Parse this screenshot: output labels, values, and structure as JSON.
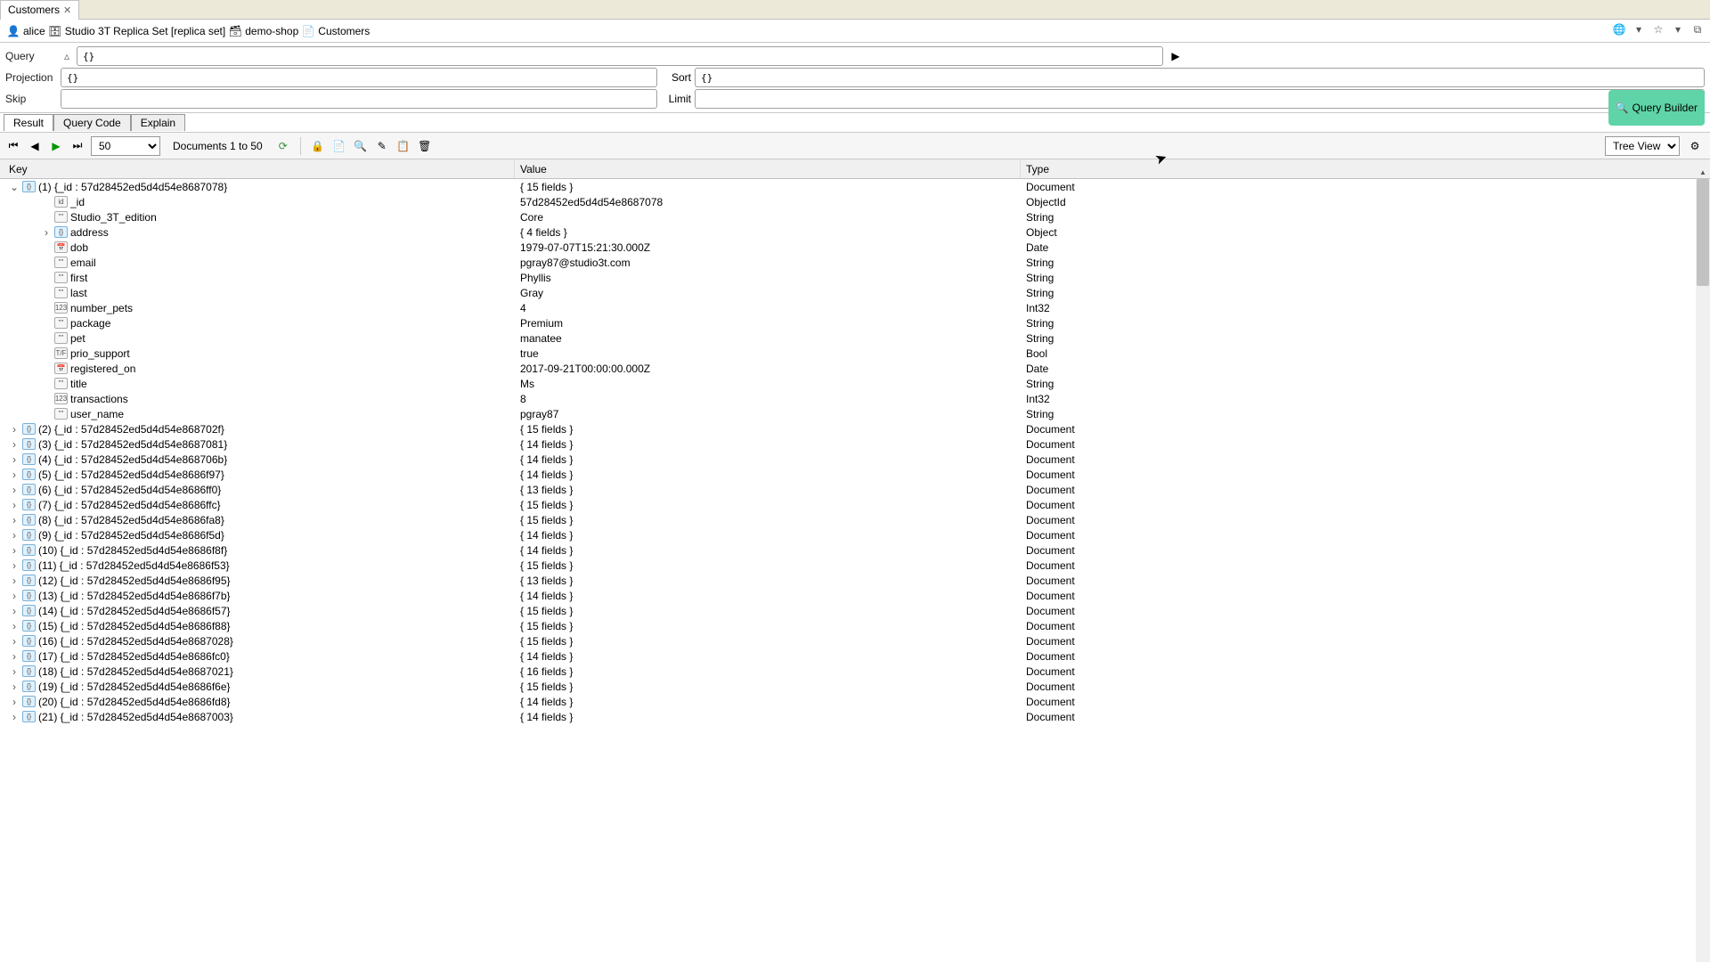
{
  "tab": {
    "title": "Customers"
  },
  "breadcrumb": {
    "user": "alice",
    "connection": "Studio 3T Replica Set [replica set]",
    "database": "demo-shop",
    "collection": "Customers"
  },
  "query_form": {
    "query_label": "Query",
    "query_value": "{}",
    "projection_label": "Projection",
    "projection_value": "{}",
    "sort_label": "Sort",
    "sort_value": "{}",
    "skip_label": "Skip",
    "skip_value": "",
    "limit_label": "Limit",
    "limit_value": "",
    "builder_label": "Query Builder"
  },
  "result_tabs": {
    "result": "Result",
    "code": "Query Code",
    "explain": "Explain"
  },
  "toolbar": {
    "page_size": "50",
    "doc_range": "Documents 1 to 50",
    "view_mode": "Tree View"
  },
  "grid_headers": {
    "key": "Key",
    "value": "Value",
    "type": "Type"
  },
  "doc1": {
    "key": "(1) {_id : 57d28452ed5d4d54e8687078}",
    "value": "{ 15 fields }",
    "type": "Document",
    "fields": [
      {
        "k": "_id",
        "v": "57d28452ed5d4d54e8687078",
        "t": "ObjectId",
        "icon": "id"
      },
      {
        "k": "Studio_3T_edition",
        "v": "Core",
        "t": "String",
        "icon": "str"
      },
      {
        "k": "address",
        "v": "{ 4 fields }",
        "t": "Object",
        "icon": "obj",
        "expandable": true
      },
      {
        "k": "dob",
        "v": "1979-07-07T15:21:30.000Z",
        "t": "Date",
        "icon": "date"
      },
      {
        "k": "email",
        "v": "pgray87@studio3t.com",
        "t": "String",
        "icon": "str"
      },
      {
        "k": "first",
        "v": "Phyllis",
        "t": "String",
        "icon": "str"
      },
      {
        "k": "last",
        "v": "Gray",
        "t": "String",
        "icon": "str"
      },
      {
        "k": "number_pets",
        "v": "4",
        "t": "Int32",
        "icon": "int"
      },
      {
        "k": "package",
        "v": "Premium",
        "t": "String",
        "icon": "str"
      },
      {
        "k": "pet",
        "v": "manatee",
        "t": "String",
        "icon": "str"
      },
      {
        "k": "prio_support",
        "v": "true",
        "t": "Bool",
        "icon": "bool"
      },
      {
        "k": "registered_on",
        "v": "2017-09-21T00:00:00.000Z",
        "t": "Date",
        "icon": "date"
      },
      {
        "k": "title",
        "v": "Ms",
        "t": "String",
        "icon": "str"
      },
      {
        "k": "transactions",
        "v": "8",
        "t": "Int32",
        "icon": "int"
      },
      {
        "k": "user_name",
        "v": "pgray87",
        "t": "String",
        "icon": "str"
      }
    ]
  },
  "other_docs": [
    {
      "k": "(2) {_id : 57d28452ed5d4d54e868702f}",
      "v": "{ 15 fields }",
      "t": "Document"
    },
    {
      "k": "(3) {_id : 57d28452ed5d4d54e8687081}",
      "v": "{ 14 fields }",
      "t": "Document"
    },
    {
      "k": "(4) {_id : 57d28452ed5d4d54e868706b}",
      "v": "{ 14 fields }",
      "t": "Document"
    },
    {
      "k": "(5) {_id : 57d28452ed5d4d54e8686f97}",
      "v": "{ 14 fields }",
      "t": "Document"
    },
    {
      "k": "(6) {_id : 57d28452ed5d4d54e8686ff0}",
      "v": "{ 13 fields }",
      "t": "Document"
    },
    {
      "k": "(7) {_id : 57d28452ed5d4d54e8686ffc}",
      "v": "{ 15 fields }",
      "t": "Document"
    },
    {
      "k": "(8) {_id : 57d28452ed5d4d54e8686fa8}",
      "v": "{ 15 fields }",
      "t": "Document"
    },
    {
      "k": "(9) {_id : 57d28452ed5d4d54e8686f5d}",
      "v": "{ 14 fields }",
      "t": "Document"
    },
    {
      "k": "(10) {_id : 57d28452ed5d4d54e8686f8f}",
      "v": "{ 14 fields }",
      "t": "Document"
    },
    {
      "k": "(11) {_id : 57d28452ed5d4d54e8686f53}",
      "v": "{ 15 fields }",
      "t": "Document"
    },
    {
      "k": "(12) {_id : 57d28452ed5d4d54e8686f95}",
      "v": "{ 13 fields }",
      "t": "Document"
    },
    {
      "k": "(13) {_id : 57d28452ed5d4d54e8686f7b}",
      "v": "{ 14 fields }",
      "t": "Document"
    },
    {
      "k": "(14) {_id : 57d28452ed5d4d54e8686f57}",
      "v": "{ 15 fields }",
      "t": "Document"
    },
    {
      "k": "(15) {_id : 57d28452ed5d4d54e8686f88}",
      "v": "{ 15 fields }",
      "t": "Document"
    },
    {
      "k": "(16) {_id : 57d28452ed5d4d54e8687028}",
      "v": "{ 15 fields }",
      "t": "Document"
    },
    {
      "k": "(17) {_id : 57d28452ed5d4d54e8686fc0}",
      "v": "{ 14 fields }",
      "t": "Document"
    },
    {
      "k": "(18) {_id : 57d28452ed5d4d54e8687021}",
      "v": "{ 16 fields }",
      "t": "Document"
    },
    {
      "k": "(19) {_id : 57d28452ed5d4d54e8686f6e}",
      "v": "{ 15 fields }",
      "t": "Document"
    },
    {
      "k": "(20) {_id : 57d28452ed5d4d54e8686fd8}",
      "v": "{ 14 fields }",
      "t": "Document"
    },
    {
      "k": "(21) {_id : 57d28452ed5d4d54e8687003}",
      "v": "{ 14 fields }",
      "t": "Document"
    }
  ]
}
